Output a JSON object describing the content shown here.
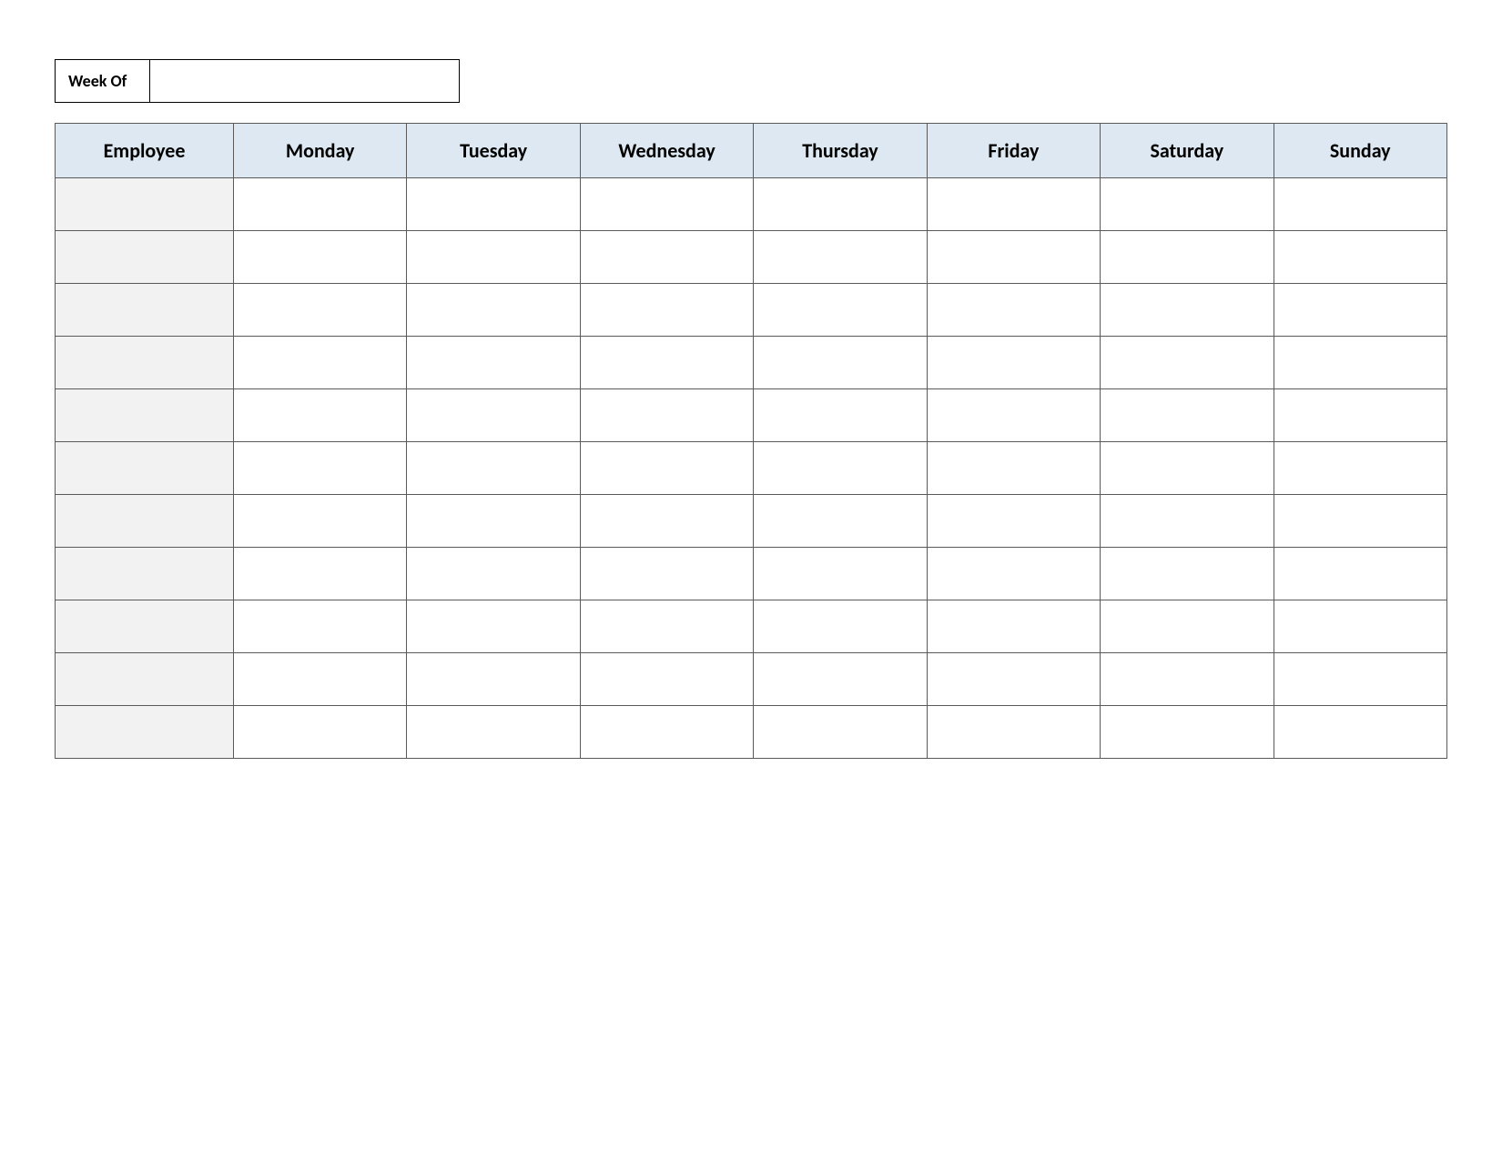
{
  "weekOf": {
    "label": "Week Of",
    "value": ""
  },
  "table": {
    "headers": [
      "Employee",
      "Monday",
      "Tuesday",
      "Wednesday",
      "Thursday",
      "Friday",
      "Saturday",
      "Sunday"
    ],
    "rows": [
      {
        "employee": "",
        "monday": "",
        "tuesday": "",
        "wednesday": "",
        "thursday": "",
        "friday": "",
        "saturday": "",
        "sunday": ""
      },
      {
        "employee": "",
        "monday": "",
        "tuesday": "",
        "wednesday": "",
        "thursday": "",
        "friday": "",
        "saturday": "",
        "sunday": ""
      },
      {
        "employee": "",
        "monday": "",
        "tuesday": "",
        "wednesday": "",
        "thursday": "",
        "friday": "",
        "saturday": "",
        "sunday": ""
      },
      {
        "employee": "",
        "monday": "",
        "tuesday": "",
        "wednesday": "",
        "thursday": "",
        "friday": "",
        "saturday": "",
        "sunday": ""
      },
      {
        "employee": "",
        "monday": "",
        "tuesday": "",
        "wednesday": "",
        "thursday": "",
        "friday": "",
        "saturday": "",
        "sunday": ""
      },
      {
        "employee": "",
        "monday": "",
        "tuesday": "",
        "wednesday": "",
        "thursday": "",
        "friday": "",
        "saturday": "",
        "sunday": ""
      },
      {
        "employee": "",
        "monday": "",
        "tuesday": "",
        "wednesday": "",
        "thursday": "",
        "friday": "",
        "saturday": "",
        "sunday": ""
      },
      {
        "employee": "",
        "monday": "",
        "tuesday": "",
        "wednesday": "",
        "thursday": "",
        "friday": "",
        "saturday": "",
        "sunday": ""
      },
      {
        "employee": "",
        "monday": "",
        "tuesday": "",
        "wednesday": "",
        "thursday": "",
        "friday": "",
        "saturday": "",
        "sunday": ""
      },
      {
        "employee": "",
        "monday": "",
        "tuesday": "",
        "wednesday": "",
        "thursday": "",
        "friday": "",
        "saturday": "",
        "sunday": ""
      },
      {
        "employee": "",
        "monday": "",
        "tuesday": "",
        "wednesday": "",
        "thursday": "",
        "friday": "",
        "saturday": "",
        "sunday": ""
      }
    ]
  }
}
